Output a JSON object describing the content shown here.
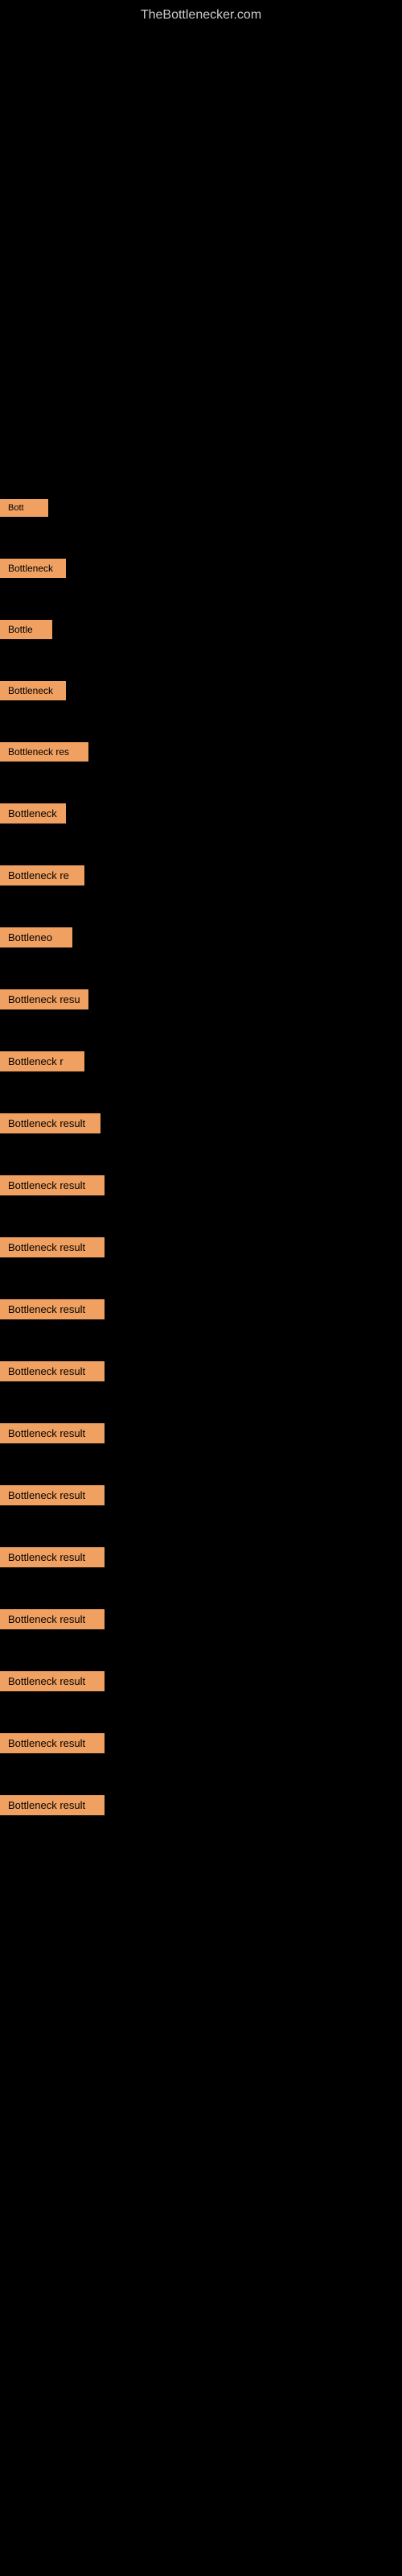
{
  "site": {
    "title": "TheBottlenecker.com"
  },
  "results": [
    {
      "label": "Bott"
    },
    {
      "label": "Bottleneck"
    },
    {
      "label": "Bottle"
    },
    {
      "label": "Bottleneck"
    },
    {
      "label": "Bottleneck res"
    },
    {
      "label": "Bottleneck"
    },
    {
      "label": "Bottleneck re"
    },
    {
      "label": "Bottleneo"
    },
    {
      "label": "Bottleneck resu"
    },
    {
      "label": "Bottleneck r"
    },
    {
      "label": "Bottleneck result"
    },
    {
      "label": "Bottleneck result"
    },
    {
      "label": "Bottleneck result"
    },
    {
      "label": "Bottleneck result"
    },
    {
      "label": "Bottleneck result"
    },
    {
      "label": "Bottleneck result"
    },
    {
      "label": "Bottleneck result"
    },
    {
      "label": "Bottleneck result"
    },
    {
      "label": "Bottleneck result"
    },
    {
      "label": "Bottleneck result"
    },
    {
      "label": "Bottleneck result"
    },
    {
      "label": "Bottleneck result"
    }
  ]
}
